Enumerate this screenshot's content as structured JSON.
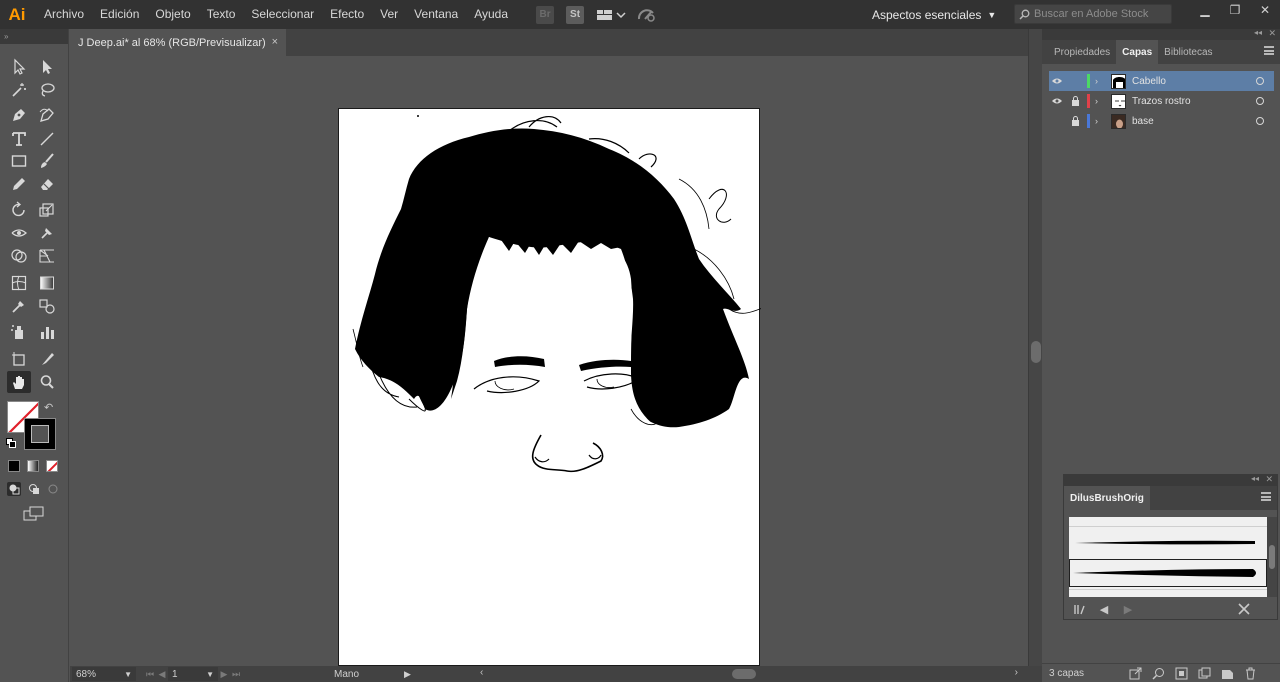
{
  "app": {
    "logo": "Ai"
  },
  "menu": {
    "items": [
      "Archivo",
      "Edición",
      "Objeto",
      "Texto",
      "Seleccionar",
      "Efecto",
      "Ver",
      "Ventana",
      "Ayuda"
    ],
    "bridge_label": "Br",
    "stock_label": "St"
  },
  "workspace": {
    "label": "Aspectos esenciales"
  },
  "search": {
    "placeholder": "Buscar en Adobe Stock"
  },
  "document": {
    "tab_title": "J Deep.ai* al 68% (RGB/Previsualizar)",
    "close": "×"
  },
  "status": {
    "zoom": "68%",
    "page": "1",
    "tool": "Mano"
  },
  "layers_panel": {
    "tabs": [
      "Propiedades",
      "Capas",
      "Bibliotecas"
    ],
    "active_tab": "Capas",
    "layers": [
      {
        "name": "Cabello",
        "visible": true,
        "locked": false,
        "color": "#4cd965",
        "selected": true
      },
      {
        "name": "Trazos rostro",
        "visible": true,
        "locked": true,
        "color": "#e0414a",
        "selected": false
      },
      {
        "name": "base",
        "visible": false,
        "locked": true,
        "color": "#4a78d8",
        "selected": false
      }
    ],
    "count_label": "3 capas"
  },
  "brush_panel": {
    "title": "DilusBrushOrig"
  },
  "colors": {
    "accent_selected": "#5d7ea6",
    "logo": "#ff9a00"
  }
}
